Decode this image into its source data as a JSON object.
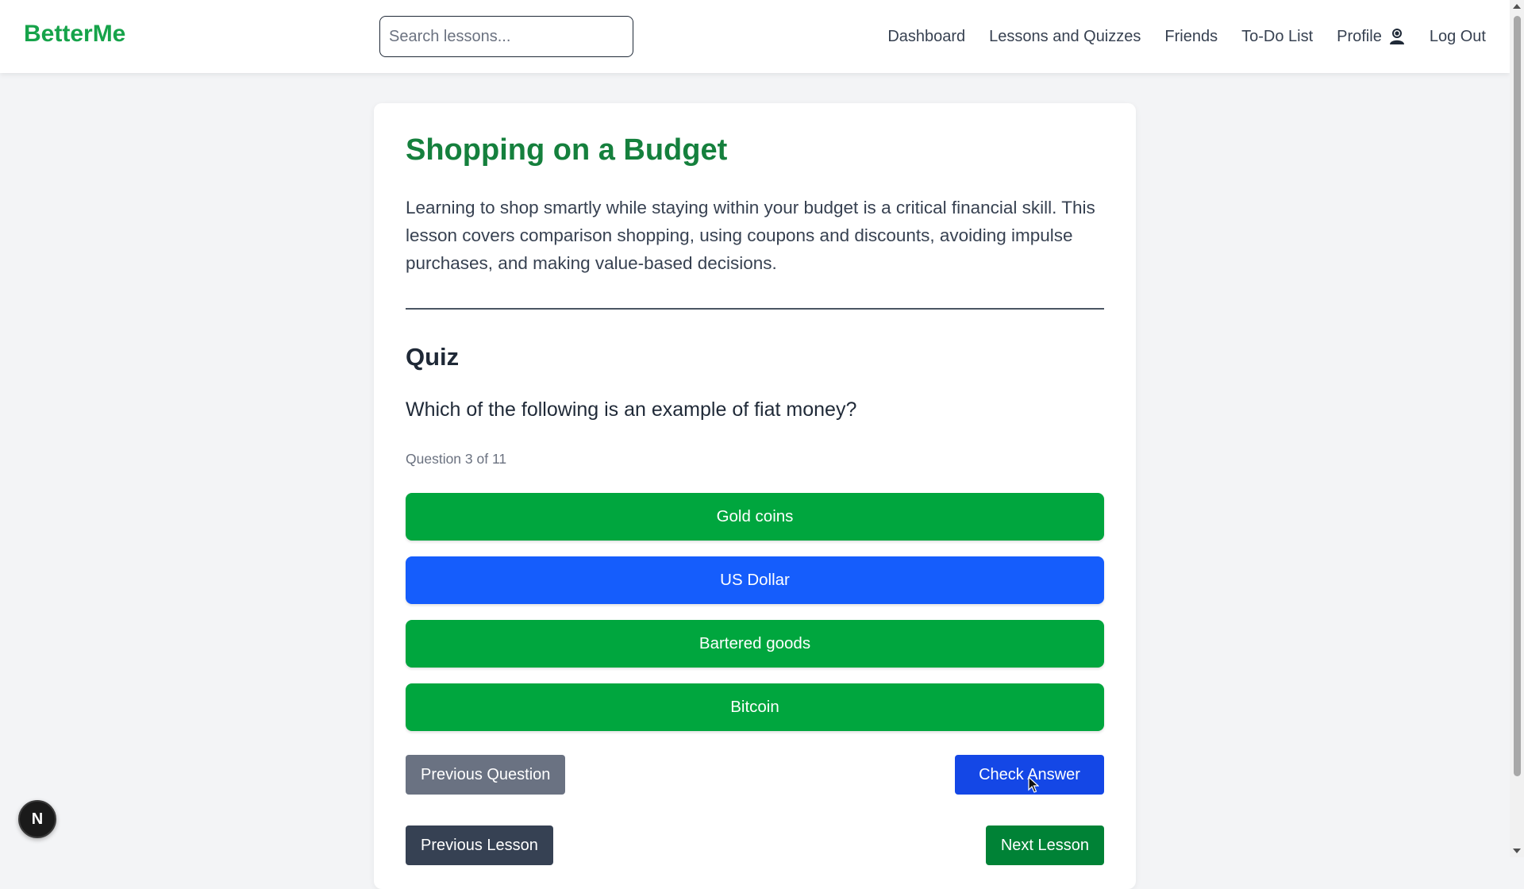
{
  "header": {
    "brand": "BetterMe",
    "search_placeholder": "Search lessons...",
    "nav": [
      "Dashboard",
      "Lessons and Quizzes",
      "Friends",
      "To-Do List",
      "Profile",
      "Log Out"
    ],
    "profile_icon": "user-icon"
  },
  "lesson": {
    "title": "Shopping on a Budget",
    "description": "Learning to shop smartly while staying within your budget is a critical financial skill. This lesson covers comparison shopping, using coupons and discounts, avoiding impulse purchases, and making value-based decisions."
  },
  "quiz": {
    "heading": "Quiz",
    "question": "Which of the following is an example of fiat money?",
    "counter": "Question 3 of 11",
    "options": [
      "Gold coins",
      "US Dollar",
      "Bartered goods",
      "Bitcoin"
    ],
    "selected_option": "US Dollar"
  },
  "controls": {
    "previous_question": "Previous Question",
    "check_answer": "Check Answer",
    "previous_lesson": "Previous Lesson",
    "next_lesson": "Next Lesson"
  },
  "badge": {
    "letter": "N"
  },
  "colors": {
    "brand_green": "#16a34a",
    "option_green": "#00a63e",
    "selected_blue": "#155dfc",
    "check_blue": "#1447e6",
    "prev_question_gray": "#6a7282",
    "prev_lesson_slate": "#364153",
    "next_lesson_green": "#008236"
  }
}
